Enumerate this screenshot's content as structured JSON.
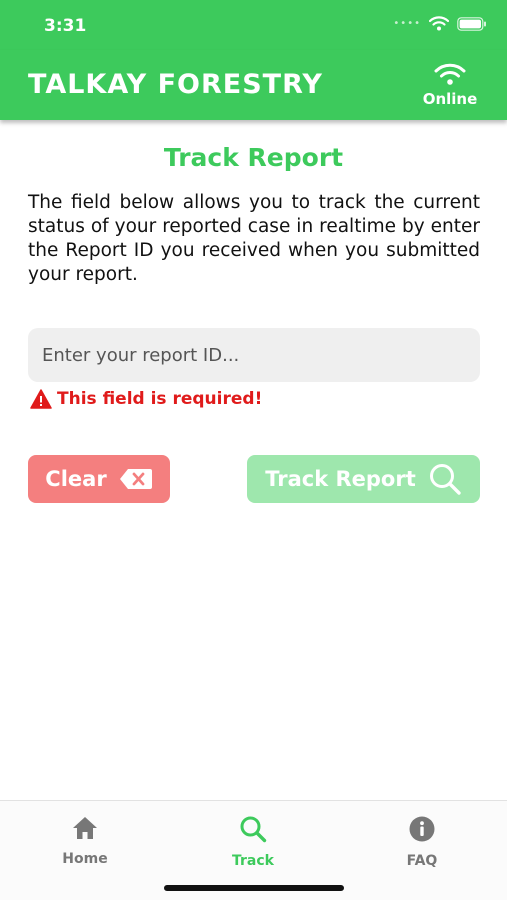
{
  "status_bar": {
    "time": "3:31"
  },
  "header": {
    "title": "TALKAY FORESTRY",
    "connection_status": "Online",
    "connection_icon": "wifi-icon"
  },
  "page": {
    "title": "Track Report",
    "description": "The field below allows you to track the current status of your reported case in realtime by enter the Report ID you received when you submitted your report."
  },
  "form": {
    "report_id": {
      "value": "",
      "placeholder": "Enter your report ID..."
    },
    "error_message": "This field is required!",
    "error_icon": "warning-icon"
  },
  "buttons": {
    "clear_label": "Clear",
    "clear_icon": "backspace-icon",
    "track_label": "Track Report",
    "track_icon": "search-icon"
  },
  "tabs": [
    {
      "label": "Home",
      "icon": "home-icon",
      "active": false
    },
    {
      "label": "Track",
      "icon": "search-icon",
      "active": true
    },
    {
      "label": "FAQ",
      "icon": "info-icon",
      "active": false
    }
  ],
  "colors": {
    "primary": "#3dca5c",
    "clear_button": "#f47f7f",
    "track_button": "#9ee7ad",
    "error": "#e01b1b",
    "input_background": "#efefef"
  }
}
